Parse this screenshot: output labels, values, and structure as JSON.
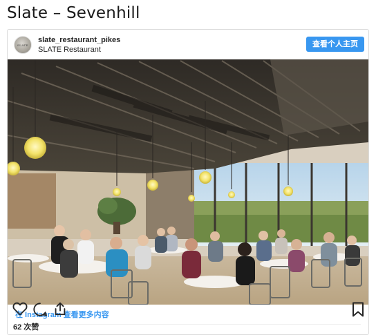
{
  "page": {
    "title": "Slate – Sevenhill"
  },
  "post": {
    "username": "slate_restaurant_pikes",
    "account_name": "SLATE Restaurant",
    "avatar_text": "SLATE",
    "profile_button_label": "查看个人主页",
    "more_link_label": "在 Instagram 查看更多内容",
    "likes_label": "62 次赞"
  },
  "icons": {
    "like": "heart-icon",
    "comment": "comment-icon",
    "share": "share-icon",
    "save": "bookmark-icon"
  },
  "colors": {
    "accent": "#3897f0",
    "text": "#262626",
    "border": "#dbdbdb"
  }
}
